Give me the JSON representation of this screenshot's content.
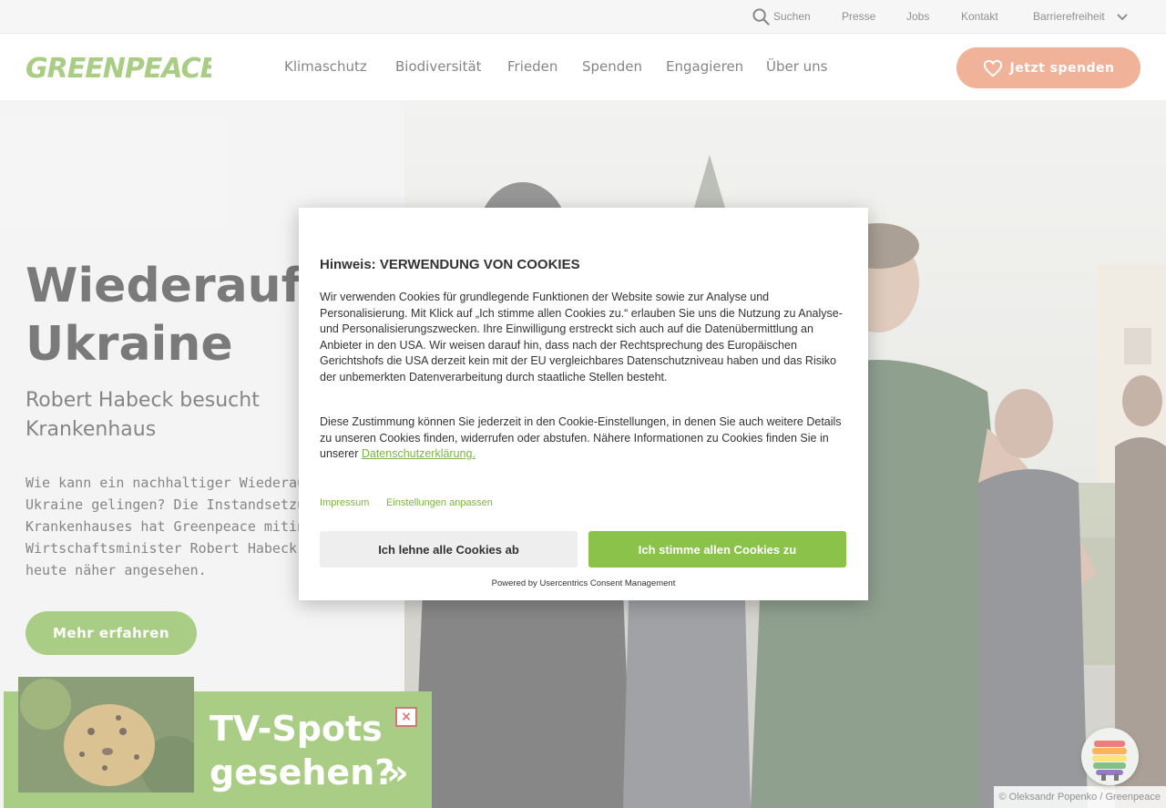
{
  "topbar": {
    "search_label": "Suchen",
    "presse": "Presse",
    "jobs": "Jobs",
    "kontakt": "Kontakt",
    "barrierefreiheit": "Barrierefreiheit"
  },
  "logo_text": "GREENPEACE",
  "nav": {
    "items": [
      "Klimaschutz",
      "Biodiversität",
      "Frieden",
      "Spenden",
      "Engagieren",
      "Über uns"
    ],
    "donate_label": "Jetzt spenden"
  },
  "hero": {
    "title_line1": "Wiederaufbau",
    "title_line2": "Ukraine",
    "subtitle": "Robert Habeck besucht Krankenhaus",
    "body": "Wie kann ein nachhaltiger Wiederaufbau\nUkraine gelingen? Die Instandsetzung e\nKrankenhauses hat Greenpeace mitinit\nWirtschaftsminister Robert Habeck hat\nheute näher angesehen.",
    "cta": "Mehr erfahren",
    "photo_credit": "© Oleksandr Popenko / Greenpeace"
  },
  "tv_banner": {
    "text": "TV-Spots gesehen?",
    "arrow": "»",
    "close": "×"
  },
  "cookie_modal": {
    "title": "Hinweis: VERWENDUNG VON COOKIES",
    "paragraph1": "Wir verwenden Cookies für grundlegende Funktionen der Website sowie zur Analyse und Personalisierung. Mit Klick auf „Ich stimme allen Cookies zu.“ erlauben Sie uns die Nutzung zu Analyse- und Personalisierungszwecken. Ihre Einwilligung erstreckt sich auch auf die Datenübermittlung an Anbieter in den USA. Wir weisen darauf hin, dass nach der Rechtsprechung des Europäischen Gerichtshofs die USA derzeit kein mit der EU vergleichbares Datenschutzniveau haben und das Risiko der unbemerkten Datenverarbeitung durch staatliche Stellen besteht.",
    "paragraph2": "Diese Zustimmung können Sie jederzeit in den Cookie-Einstellungen, in denen Sie auch weitere Details zu unseren Cookies finden, widerrufen oder abstufen. Nähere Informationen zu Cookies finden Sie in unserer ",
    "privacy_link": "Datenschutzerklärung.",
    "impressum": "Impressum",
    "settings": "Einstellungen anpassen",
    "deny": "Ich lehne alle Cookies ab",
    "accept": "Ich stimme allen Cookies zu",
    "powered_by": "Powered by Usercentrics Consent Management"
  },
  "colors": {
    "brand_green": "#7cb342",
    "donate_orange": "#e88962",
    "accept_green": "#8bc34a"
  }
}
